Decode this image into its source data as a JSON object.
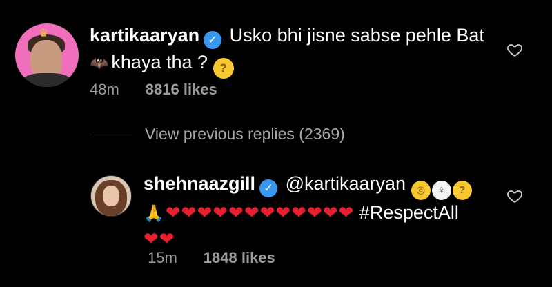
{
  "comment1": {
    "username": "kartikaaryan",
    "text_line1": "Usko bhi jisne sabse pehle Bat",
    "text_line2": "khaya tha ?",
    "time": "48m",
    "likes": "8816 likes"
  },
  "view_replies": "View previous replies (2369)",
  "comment2": {
    "username": "shehnaazgill",
    "mention": "@kartikaaryan",
    "hearts_line1": "❤❤❤❤❤❤❤❤❤❤❤❤",
    "hashtag": "#RespectAll",
    "hearts_line2": "❤❤",
    "time": "15m",
    "likes": "1848 likes"
  },
  "colors": {
    "background": "#000000",
    "verified": "#3897f0",
    "meta_text": "#9b9b9b",
    "heart": "#e8202e"
  },
  "icons": {
    "verified": "verified-badge-icon",
    "like": "heart-outline-icon",
    "bat": "bat-emoji",
    "thinking": "thinking-face-emoji",
    "face_with_monocle": "face-with-monocle-emoji",
    "shrug": "person-shrugging-emoji",
    "pray": "folded-hands-emoji"
  }
}
